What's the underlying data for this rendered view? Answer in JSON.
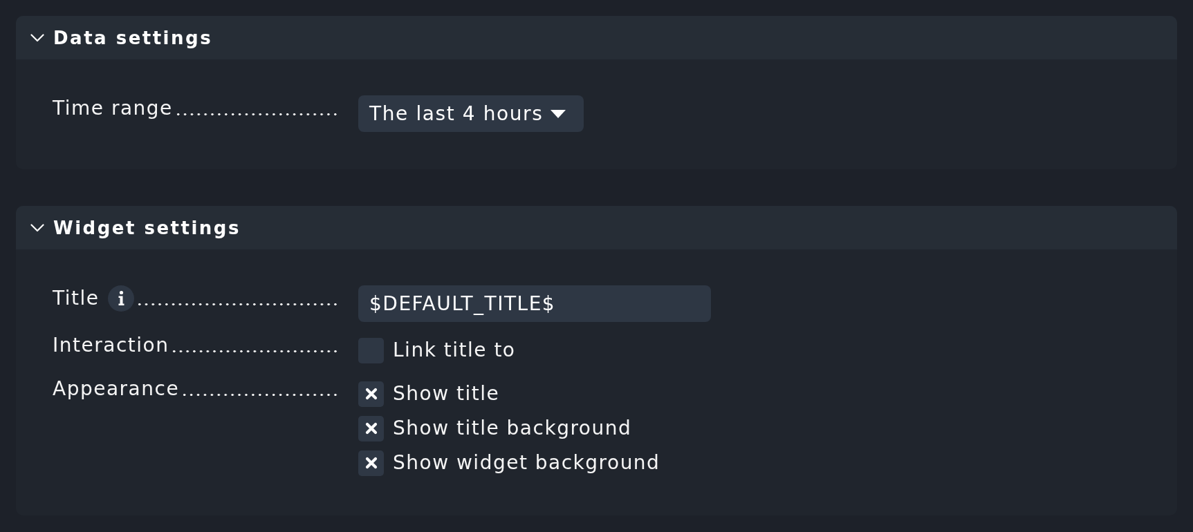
{
  "sections": [
    {
      "title": "Data settings",
      "expanded": true,
      "rows": [
        {
          "label": "Time range",
          "info": false,
          "control": {
            "kind": "dropdown",
            "value": "The last 4 hours"
          }
        }
      ]
    },
    {
      "title": "Widget settings",
      "expanded": true,
      "rows": [
        {
          "label": "Title",
          "info": true,
          "control": {
            "kind": "text",
            "value": "$DEFAULT_TITLE$"
          }
        },
        {
          "label": "Interaction",
          "info": false,
          "control": {
            "kind": "checkboxes",
            "options": [
              {
                "label": "Link title to",
                "checked": false
              }
            ]
          }
        },
        {
          "label": "Appearance",
          "info": false,
          "control": {
            "kind": "checkboxes",
            "options": [
              {
                "label": "Show title",
                "checked": true
              },
              {
                "label": "Show title background",
                "checked": true
              },
              {
                "label": "Show widget background",
                "checked": true
              }
            ]
          }
        }
      ]
    }
  ]
}
